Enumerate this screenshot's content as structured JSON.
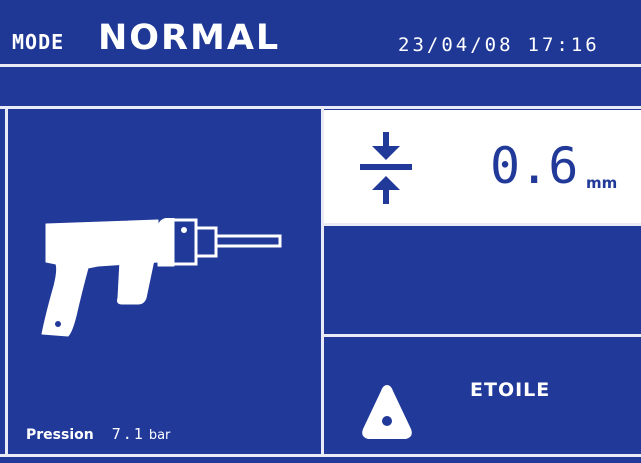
{
  "header": {
    "mode_prefix": "MODE",
    "mode_value": "NORMAL",
    "date": "23/04/08",
    "time": "17:16"
  },
  "left_panel": {
    "tool_icon": "spot-welding-gun-icon",
    "pressure_label": "Pression",
    "pressure_value": "7.1",
    "pressure_unit": "bar"
  },
  "thickness": {
    "icon": "sheet-thickness-icon",
    "value": "0.6",
    "unit": "mm"
  },
  "electrode": {
    "icon": "triangle-electrode-icon",
    "label": "ETOILE"
  },
  "colors": {
    "background": "#213a9a",
    "foreground": "#ffffff"
  }
}
